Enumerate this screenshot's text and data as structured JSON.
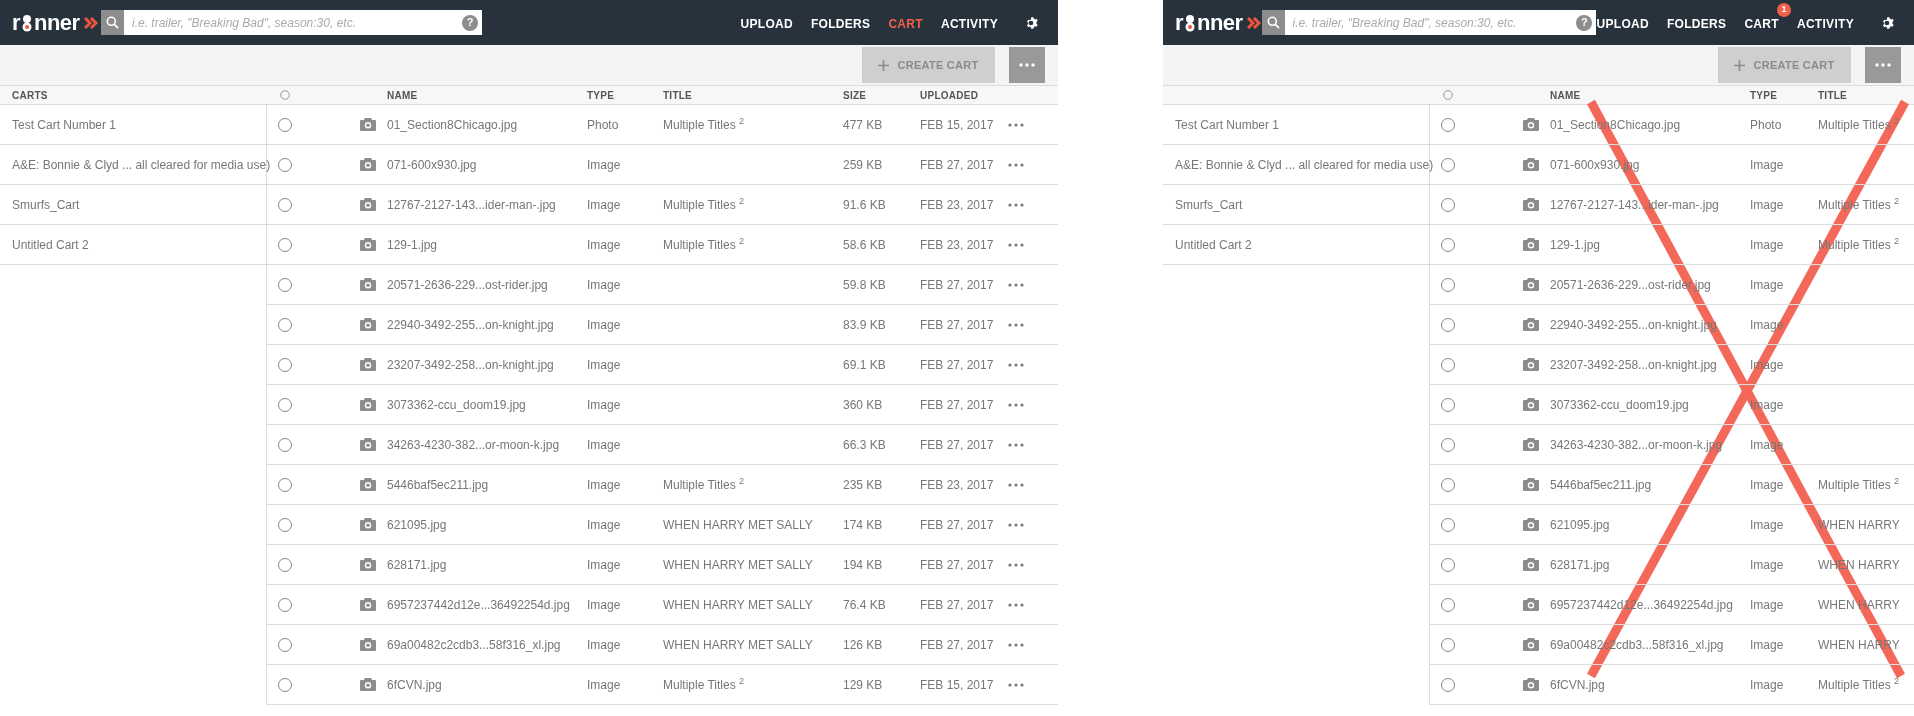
{
  "screens": [
    {
      "logo": {
        "left": "r",
        "right": "nner"
      },
      "search": {
        "placeholder": "i.e. trailer, \"Breaking Bad\", season:30, etc.",
        "help": "?"
      },
      "nav": [
        {
          "label": "UPLOAD",
          "selected": false
        },
        {
          "label": "FOLDERS",
          "selected": false
        },
        {
          "label": "CART",
          "selected": true
        },
        {
          "label": "ACTIVITY",
          "selected": false
        }
      ],
      "toolbar": {
        "create_button": "CREATE CART"
      },
      "columns": {
        "carts": "CARTS",
        "name": "NAME",
        "type": "TYPE",
        "title": "TITLE",
        "size": "SIZE",
        "uploaded": "UPLOADED"
      },
      "carts": [
        "Test Cart Number 1",
        "A&E: Bonnie & Clyd ... all cleared for media use)",
        "Smurfs_Cart",
        "Untitled Cart 2"
      ],
      "rows": [
        {
          "selected": false,
          "name": "01_Section8Chicago.jpg",
          "type": "Photo",
          "title": "Multiple Titles $^{2}$",
          "size": "477 KB",
          "uploaded": "FEB 15, 2017"
        },
        {
          "selected": false,
          "name": "071-600x930.jpg",
          "type": "Image",
          "size": "259 KB",
          "uploaded": "FEB 27, 2017"
        },
        {
          "selected": false,
          "name": "12767-2127-143...ider-man-.jpg",
          "type": "Image",
          "title": "Multiple Titles $^{2}$",
          "size": "91.6 KB",
          "uploaded": "FEB 23, 2017"
        },
        {
          "selected": false,
          "name": "129-1.jpg",
          "type": "Image",
          "title": "Multiple Titles $^{2}$",
          "size": "58.6 KB",
          "uploaded": "FEB 23, 2017"
        },
        {
          "selected": false,
          "name": "20571-2636-229...ost-rider.jpg",
          "type": "Image",
          "size": "59.8 KB",
          "uploaded": "FEB 27, 2017"
        },
        {
          "selected": false,
          "name": "22940-3492-255...on-knight.jpg",
          "type": "Image",
          "size": "83.9 KB",
          "uploaded": "FEB 27, 2017"
        },
        {
          "selected": false,
          "name": "23207-3492-258...on-knight.jpg",
          "type": "Image",
          "size": "69.1 KB",
          "uploaded": "FEB 27, 2017"
        },
        {
          "selected": false,
          "name": "3073362-ccu_doom19.jpg",
          "type": "Image",
          "size": "360 KB",
          "uploaded": "FEB 27, 2017"
        },
        {
          "selected": false,
          "name": "34263-4230-382...or-moon-k.jpg",
          "type": "Image",
          "size": "66.3 KB",
          "uploaded": "FEB 27, 2017"
        },
        {
          "selected": false,
          "name": "5446baf5ec211.jpg",
          "type": "Image",
          "title": "Multiple Titles $^{2}$",
          "size": "235 KB",
          "uploaded": "FEB 23, 2017"
        },
        {
          "selected": false,
          "name": "621095.jpg",
          "type": "Image",
          "title": "WHEN HARRY MET SALLY",
          "size": "174 KB",
          "uploaded": "FEB 27, 2017"
        },
        {
          "selected": false,
          "name": "628171.jpg",
          "type": "Image",
          "title": "WHEN HARRY MET SALLY",
          "size": "194 KB",
          "uploaded": "FEB 27, 2017"
        },
        {
          "selected": false,
          "name": "6957237442d12e...36492254d.jpg",
          "type": "Image",
          "title": "WHEN HARRY MET SALLY",
          "size": "76.4 KB",
          "uploaded": "FEB 27, 2017"
        },
        {
          "selected": false,
          "name": "69a00482c2cdb3...58f316_xl.jpg",
          "type": "Image",
          "title": "WHEN HARRY MET SALLY",
          "size": "126 KB",
          "uploaded": "FEB 27, 2017"
        },
        {
          "selected": false,
          "name": "6fCVN.jpg",
          "type": "Image",
          "title": "Multiple Titles $^{2}$",
          "size": "129 KB",
          "uploaded": "FEB 15, 2017"
        }
      ],
      "crossed_out": false
    },
    {
      "logo": {
        "left": "r",
        "right": "nner"
      },
      "search": {
        "placeholder": "i.e. trailer, \"Breaking Bad\", season:30, etc.",
        "help": "?"
      },
      "nav": [
        {
          "label": "UPLOAD",
          "selected": false
        },
        {
          "label": "FOLDERS",
          "selected": false
        },
        {
          "label": "CART",
          "selected": false,
          "badge": "1"
        },
        {
          "label": "ACTIVITY",
          "selected": false
        }
      ],
      "toolbar": {
        "create_button": "CREATE CART"
      },
      "columns": {
        "name": "NAME",
        "type": "TYPE",
        "title": "TITLE"
      },
      "carts": [
        "Test Cart Number 1",
        "A&E: Bonnie & Clyd ... all cleared for media use)",
        "Smurfs_Cart",
        "Untitled Cart 2"
      ],
      "rows": [
        {
          "selected": false,
          "name": "01_Section8Chicago.jpg",
          "type": "Photo",
          "title": "Multiple Titles $^{2}$"
        },
        {
          "selected": false,
          "name": "071-600x930.jpg",
          "type": "Image"
        },
        {
          "selected": false,
          "name": "12767-2127-143...ider-man-.jpg",
          "type": "Image",
          "title": "Multiple Titles $^{2}$"
        },
        {
          "selected": false,
          "name": "129-1.jpg",
          "type": "Image",
          "title": "Multiple Titles $^{2}$"
        },
        {
          "selected": false,
          "name": "20571-2636-229...ost-rider.jpg",
          "type": "Image"
        },
        {
          "selected": false,
          "name": "22940-3492-255...on-knight.jpg",
          "type": "Image"
        },
        {
          "selected": false,
          "name": "23207-3492-258...on-knight.jpg",
          "type": "Image"
        },
        {
          "selected": false,
          "name": "3073362-ccu_doom19.jpg",
          "type": "Image"
        },
        {
          "selected": false,
          "name": "34263-4230-382...or-moon-k.jpg",
          "type": "Image"
        },
        {
          "selected": false,
          "name": "5446baf5ec211.jpg",
          "type": "Image",
          "title": "Multiple Titles $^{2}$"
        },
        {
          "selected": false,
          "name": "621095.jpg",
          "type": "Image",
          "title": "WHEN HARRY"
        },
        {
          "selected": false,
          "name": "628171.jpg",
          "type": "Image",
          "title": "WHEN HARRY"
        },
        {
          "selected": false,
          "name": "6957237442d12e...36492254d.jpg",
          "type": "Image",
          "title": "WHEN HARRY"
        },
        {
          "selected": false,
          "name": "69a00482c2cdb3...58f316_xl.jpg",
          "type": "Image",
          "title": "WHEN HARRY"
        },
        {
          "selected": false,
          "name": "6fCVN.jpg",
          "type": "Image",
          "title": "Multiple Titles $^{2}$"
        }
      ],
      "crossed_out": true
    }
  ]
}
